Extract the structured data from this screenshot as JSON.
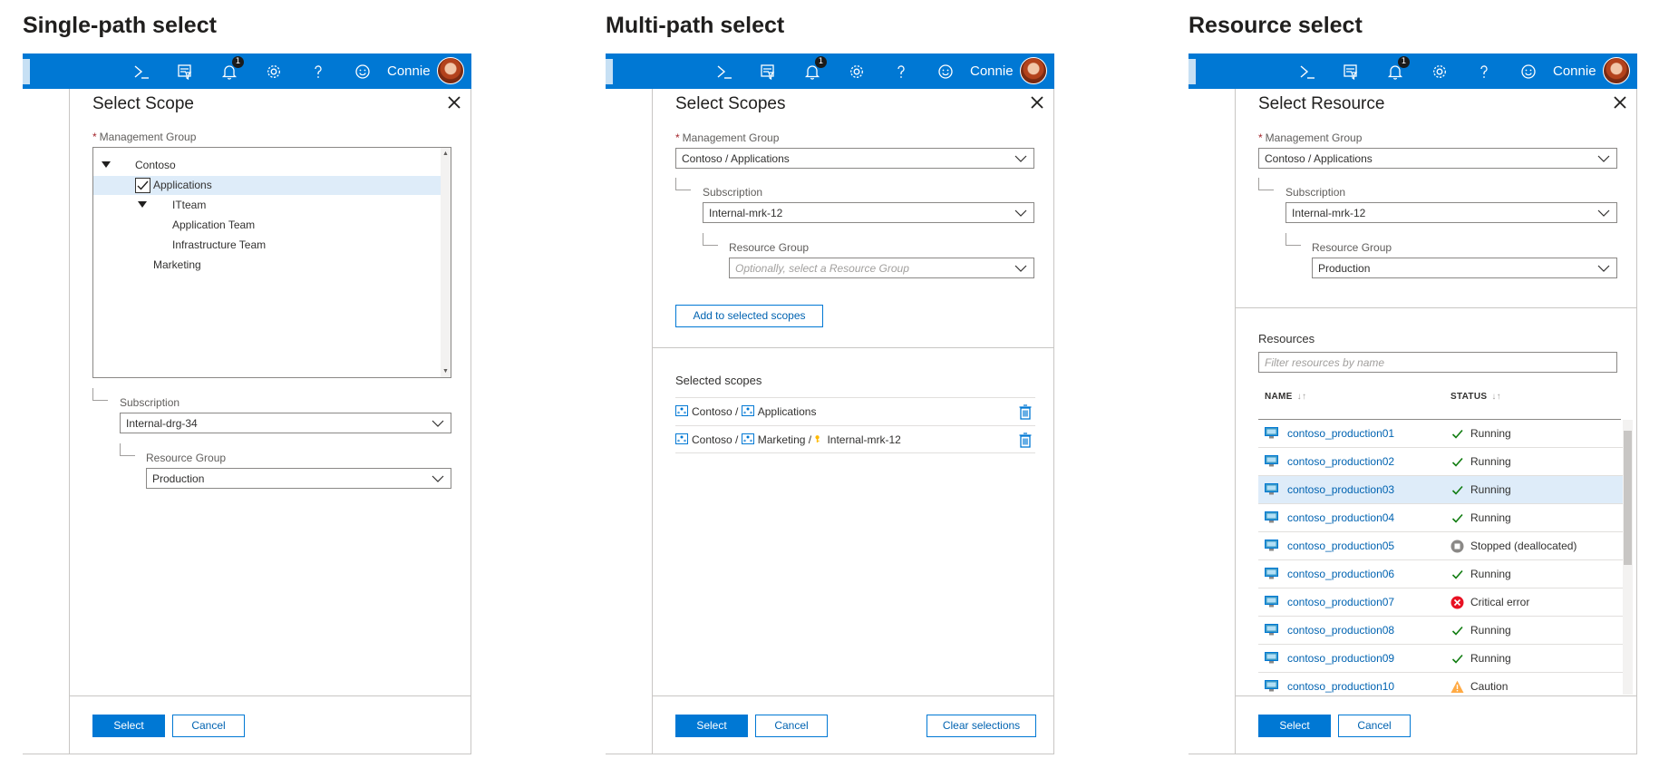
{
  "columns": [
    {
      "heading": "Single-path select",
      "topbar": {
        "user_name": "Connie",
        "notification_count": "1"
      },
      "panel": {
        "title": "Select Scope",
        "management_group_label": "Management Group",
        "tree": [
          {
            "label": "Contoso",
            "expanded": true
          },
          {
            "label": "Applications",
            "checked": true
          },
          {
            "label": "ITteam",
            "expanded": true
          },
          {
            "label": "Application Team"
          },
          {
            "label": "Infrastructure Team"
          },
          {
            "label": "Marketing"
          }
        ],
        "subscription_label": "Subscription",
        "subscription_value": "Internal-drg-34",
        "resource_group_label": "Resource Group",
        "resource_group_value": "Production",
        "select_label": "Select",
        "cancel_label": "Cancel"
      }
    },
    {
      "heading": "Multi-path select",
      "topbar": {
        "user_name": "Connie",
        "notification_count": "1"
      },
      "panel": {
        "title": "Select Scopes",
        "management_group_label": "Management Group",
        "management_group_value": "Contoso / Applications",
        "subscription_label": "Subscription",
        "subscription_value": "Internal-mrk-12",
        "resource_group_label": "Resource Group",
        "resource_group_placeholder": "Optionally, select a Resource Group",
        "add_button_label": "Add to selected scopes",
        "selected_heading": "Selected scopes",
        "selected_scopes": [
          {
            "parts": [
              "Contoso",
              "/",
              "Applications"
            ]
          },
          {
            "parts": [
              "Contoso",
              "/",
              "Marketing",
              "/",
              "Internal-mrk-12"
            ]
          }
        ],
        "select_label": "Select",
        "cancel_label": "Cancel",
        "clear_label": "Clear selections"
      }
    },
    {
      "heading": "Resource select",
      "topbar": {
        "user_name": "Connie",
        "notification_count": "1"
      },
      "panel": {
        "title": "Select Resource",
        "management_group_label": "Management Group",
        "management_group_value": "Contoso / Applications",
        "subscription_label": "Subscription",
        "subscription_value": "Internal-mrk-12",
        "resource_group_label": "Resource Group",
        "resource_group_value": "Production",
        "resources_heading": "Resources",
        "filter_placeholder": "Filter resources by name",
        "col_name": "NAME",
        "col_status": "STATUS",
        "rows": [
          {
            "name": "contoso_production01",
            "status": "Running",
            "state": "ok"
          },
          {
            "name": "contoso_production02",
            "status": "Running",
            "state": "ok"
          },
          {
            "name": "contoso_production03",
            "status": "Running",
            "state": "ok",
            "selected": true
          },
          {
            "name": "contoso_production04",
            "status": "Running",
            "state": "ok"
          },
          {
            "name": "contoso_production05",
            "status": "Stopped (deallocated)",
            "state": "stopped"
          },
          {
            "name": "contoso_production06",
            "status": "Running",
            "state": "ok"
          },
          {
            "name": "contoso_production07",
            "status": "Critical error",
            "state": "error"
          },
          {
            "name": "contoso_production08",
            "status": "Running",
            "state": "ok"
          },
          {
            "name": "contoso_production09",
            "status": "Running",
            "state": "ok"
          },
          {
            "name": "contoso_production10",
            "status": "Caution",
            "state": "warning"
          }
        ],
        "select_label": "Select",
        "cancel_label": "Cancel"
      }
    }
  ],
  "colors": {
    "brand_blue": "#0078d4",
    "selection": "#deecf9",
    "link": "#0063b1",
    "ok": "#107c10",
    "error": "#e81123",
    "warning": "#ffaa44",
    "stopped": "#8a8886"
  },
  "icons": {
    "topbar": [
      "cloud-shell-icon",
      "directory-filter-icon",
      "notifications-bell-icon",
      "settings-gear-icon",
      "help-icon",
      "feedback-smiley-icon",
      "avatar"
    ],
    "close": "close-icon",
    "delete": "trash-icon"
  }
}
